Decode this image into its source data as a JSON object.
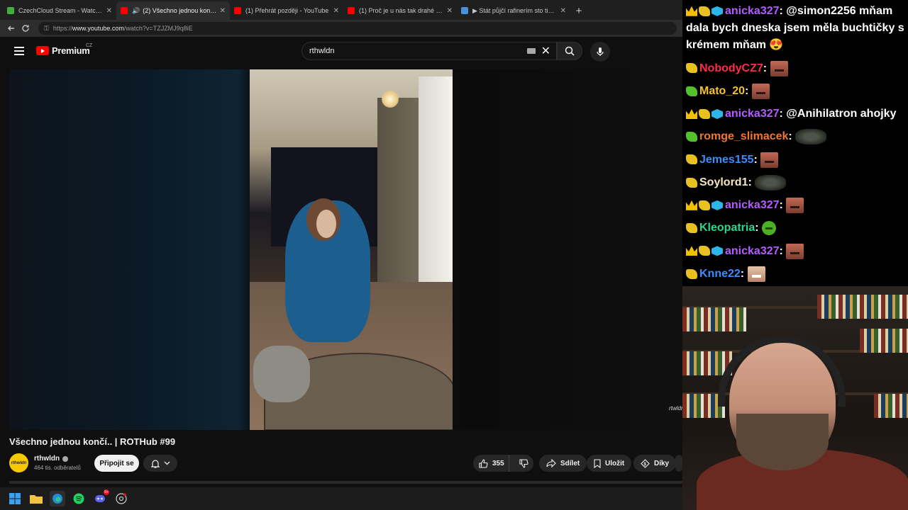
{
  "browser": {
    "tabs": [
      {
        "title": "CzechCloud Stream - Watch Live o",
        "icon": "czechcloud-icon",
        "color": "#3fae3f",
        "active": false,
        "speaker": false
      },
      {
        "title": "(2) Všechno jednou končí.. | R",
        "icon": "youtube-icon",
        "color": "#ff0000",
        "active": true,
        "speaker": true
      },
      {
        "title": "(1) Přehrát později - YouTube",
        "icon": "youtube-icon",
        "color": "#ff0000",
        "active": false,
        "speaker": false
      },
      {
        "title": "(1) Proč je u nás tak drahé bydlen",
        "icon": "youtube-icon",
        "color": "#ff0000",
        "active": false,
        "speaker": false
      },
      {
        "title": "▶ Stát půjčí rafinerím sto tisíc tun",
        "icon": "site-icon",
        "color": "#4a90d9",
        "active": false,
        "speaker": false
      }
    ],
    "url_prefix": "https://",
    "url_domain": "www.youtube.com",
    "url_path": "/watch?v=TZJZMJ9q8iE"
  },
  "youtube": {
    "logo_text": "Premium",
    "country": "CZ",
    "search_query": "rthwldn",
    "video_watermark": "rtwldn",
    "video_title": "Všechno jednou končí.. | ROTHub #99",
    "channel_name": "rthwldn",
    "channel_avatar_text": "rthwldn",
    "subscribers": "464 tis. odběratelů",
    "join_label": "Připojit se",
    "like_count": "355",
    "share_label": "Sdílet",
    "save_label": "Uložit",
    "thanks_label": "Díky"
  },
  "taskbar": {
    "icons": [
      "windows-start-icon",
      "file-explorer-icon",
      "edge-icon",
      "spotify-icon",
      "discord-icon",
      "chrome-icon"
    ],
    "discord_badge": "9+"
  },
  "chat": {
    "messages": [
      {
        "badges": [
          "crown",
          "hand",
          "cube"
        ],
        "user": "anicka327",
        "color": "#b45cff",
        "text": "@simon2256 mňam dala bych dneska jsem měla buchtičky s krémem mňam 😍",
        "emote": ""
      },
      {
        "badges": [
          "hand"
        ],
        "user": "NobodyCZ7",
        "color": "#ff2a4a",
        "text": "",
        "emote": "face"
      },
      {
        "badges": [
          "hand-green"
        ],
        "user": "Mato_20",
        "color": "#f3c22a",
        "text": "",
        "emote": "face"
      },
      {
        "badges": [
          "crown",
          "hand",
          "cube"
        ],
        "user": "anicka327",
        "color": "#b45cff",
        "text": "@Anihilatron ahojky",
        "emote": ""
      },
      {
        "badges": [
          "hand-green"
        ],
        "user": "romge_slimacek",
        "color": "#f0782a",
        "text": "",
        "emote": "wide"
      },
      {
        "badges": [
          "hand"
        ],
        "user": "Jemes155",
        "color": "#3a8dff",
        "text": "",
        "emote": "face"
      },
      {
        "badges": [
          "hand"
        ],
        "user": "Soylord1",
        "color": "#f3e6c0",
        "text": "",
        "emote": "wide"
      },
      {
        "badges": [
          "crown",
          "hand",
          "cube"
        ],
        "user": "anicka327",
        "color": "#b45cff",
        "text": "",
        "emote": "face"
      },
      {
        "badges": [
          "hand"
        ],
        "user": "Kleopatria",
        "color": "#2bd68f",
        "text": "",
        "emote": "pepe"
      },
      {
        "badges": [
          "crown",
          "hand",
          "cube"
        ],
        "user": "anicka327",
        "color": "#b45cff",
        "text": "",
        "emote": "face"
      },
      {
        "badges": [
          "hand"
        ],
        "user": "Knne22",
        "color": "#3a8dff",
        "text": "",
        "emote": "laugh"
      }
    ]
  }
}
